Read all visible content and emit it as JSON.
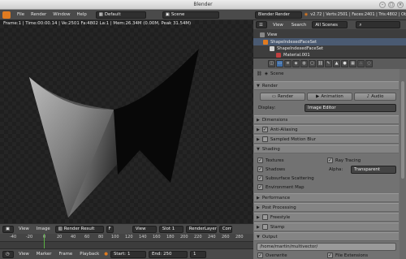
{
  "window": {
    "title": "Blender",
    "btn_min": "–",
    "btn_max": "▢",
    "btn_close": "×"
  },
  "menubar": {
    "items": [
      "File",
      "Render",
      "Window",
      "Help"
    ],
    "screen_layout": "Default",
    "scene": "Scene"
  },
  "info_right": {
    "engine": "Blender Render",
    "stats": "v2.72 | Verts:2501 | Faces:2401 | Tris:4802 | Obj"
  },
  "viewport": {
    "render_info": "Frame:1 | Time:00:00.14 | Ve:2501 Fa:4802 La:1 | Mem:26.34M (0.00M, Peak 31.54M)"
  },
  "image_header": {
    "view": "View",
    "image": "Image",
    "image_name": "Render Result",
    "f_label": "F",
    "view_menu": "View",
    "slot": "Slot 1",
    "layer": "RenderLayer",
    "combined": "Comb"
  },
  "timeline": {
    "ticks": [
      "-40",
      "-20",
      "0",
      "20",
      "40",
      "60",
      "80",
      "100",
      "120",
      "140",
      "160",
      "180",
      "200",
      "220",
      "240",
      "260",
      "280"
    ],
    "menus": [
      "View",
      "Marker",
      "Frame",
      "Playback"
    ],
    "start_label": "Start:",
    "start": "1",
    "end_label": "End:",
    "end": "250",
    "current": "1"
  },
  "outliner": {
    "view": "View",
    "search": "Search",
    "scope": "All Scenes",
    "rows": [
      {
        "label": "View",
        "color": "#888888"
      },
      {
        "label": "ShapeIndexedFaceSet",
        "color": "#e07b20"
      },
      {
        "label": "ShapeIndexedFaceSet",
        "color": "#cfcfcf"
      },
      {
        "label": "Material.001",
        "color": "#c04040"
      }
    ]
  },
  "props": {
    "context_icons": [
      "camera-icon",
      "render-layers-icon",
      "scene-icon",
      "world-icon",
      "object-icon",
      "constraint-icon",
      "modifier-icon",
      "data-icon",
      "material-icon",
      "texture-icon",
      "particles-icon",
      "physics-icon"
    ],
    "breadcrumb": "Scene",
    "render_section": "Render",
    "render_buttons": [
      "Render",
      "Animation",
      "Audio"
    ],
    "display_label": "Display:",
    "display_value": "Image Editor",
    "sections_collapsed": [
      "Dimensions",
      "Anti-Aliasing",
      "Sampled Motion Blur"
    ],
    "shading_section": "Shading",
    "shading_left": [
      "Textures",
      "Shadows",
      "Subsurface Scattering",
      "Environment Map"
    ],
    "shading_right": [
      "Ray Tracing"
    ],
    "alpha_label": "Alpha:",
    "alpha_value": "Transparent",
    "sections_collapsed2": [
      "Performance",
      "Post Processing",
      "Freestyle",
      "Stamp"
    ],
    "output_section": "Output",
    "output_path": "/home/martin/multivector/",
    "overwrite": "Overwrite",
    "file_extensions": "File Extensions"
  },
  "colors": {
    "accent": "#e07b20",
    "active_blue": "#3f6ea8",
    "playhead": "#5ab042"
  }
}
